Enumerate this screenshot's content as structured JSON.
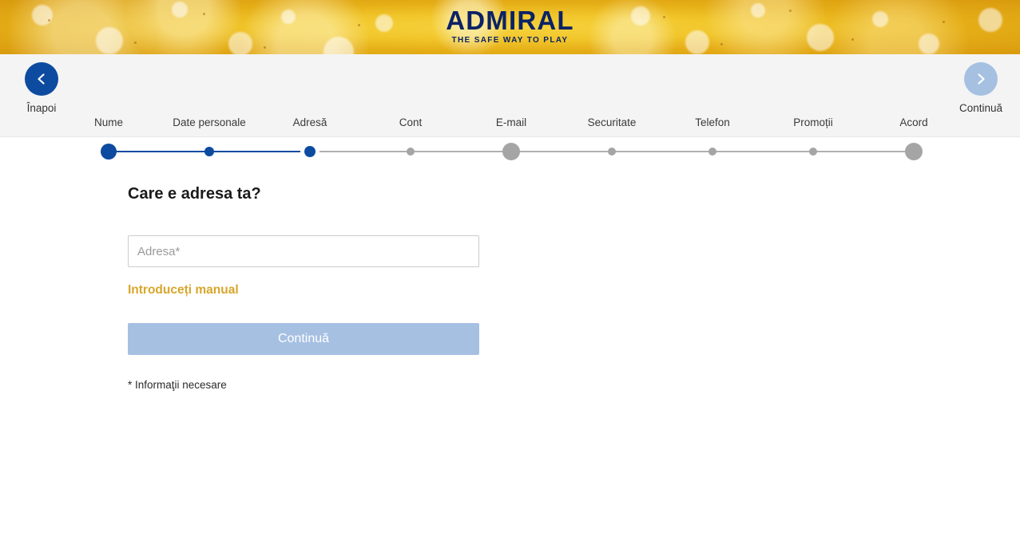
{
  "brand": {
    "logo_text": "ADMIRAL",
    "tagline": "THE SAFE WAY TO PLAY",
    "logo_color": "#0b2265",
    "banner_gold": "#f1c62b"
  },
  "nav": {
    "back_label": "Înapoi",
    "back_icon": "chevron-left-icon",
    "next_label": "Continuă",
    "next_icon": "chevron-right-icon",
    "active_color": "#0d4ba0",
    "disabled_color": "#a6c0e2"
  },
  "stepper": {
    "steps": [
      {
        "label": "Nume",
        "state": "done"
      },
      {
        "label": "Date personale",
        "state": "done"
      },
      {
        "label": "Adresă",
        "state": "current"
      },
      {
        "label": "Cont",
        "state": "todo"
      },
      {
        "label": "E-mail",
        "state": "todo"
      },
      {
        "label": "Securitate",
        "state": "todo"
      },
      {
        "label": "Telefon",
        "state": "todo"
      },
      {
        "label": "Promoții",
        "state": "todo"
      },
      {
        "label": "Acord",
        "state": "todo"
      }
    ],
    "done_color": "#0d4ba0",
    "todo_color": "#a5a5a5"
  },
  "form": {
    "heading": "Care e adresa ta?",
    "address_placeholder": "Adresa*",
    "address_value": "",
    "manual_link": "Introduceți manual",
    "manual_link_color": "#d7a62c",
    "submit_label": "Continuă",
    "footnote": "* Informaţii necesare"
  }
}
